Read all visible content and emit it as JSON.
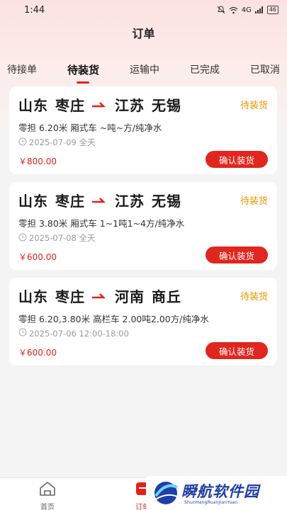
{
  "status_bar": {
    "time": "1:44",
    "network": "4G",
    "battery": "46"
  },
  "header": {
    "title": "订单"
  },
  "tabs": [
    {
      "label": "待接单"
    },
    {
      "label": "待装货",
      "active": true
    },
    {
      "label": "运输中"
    },
    {
      "label": "已完成"
    },
    {
      "label": "已取消"
    }
  ],
  "orders": [
    {
      "origin_province": "山东",
      "origin_city": "枣庄",
      "dest_province": "江苏",
      "dest_city": "无锡",
      "status": "待装货",
      "detail": "零担 6.20米 厢式车 ~吨~方/纯净水",
      "date": "2025-07-09 全天",
      "price": "￥800.00",
      "button": "确认装货"
    },
    {
      "origin_province": "山东",
      "origin_city": "枣庄",
      "dest_province": "江苏",
      "dest_city": "无锡",
      "status": "待装货",
      "detail": "零担 3.80米 厢式车 1~1吨1~4方/纯净水",
      "date": "2025-07-08 全天",
      "price": "￥600.00",
      "button": "确认装货"
    },
    {
      "origin_province": "山东",
      "origin_city": "枣庄",
      "dest_province": "河南",
      "dest_city": "商丘",
      "status": "待装货",
      "detail": "零担 6.20,3.80米 高栏车 2.00吨2.00方/纯净水",
      "date": "2025-07-06 12:00-18:00",
      "price": "￥600.00",
      "button": "确认装货"
    }
  ],
  "bottom_nav": {
    "home_label": "首页",
    "orders_label": "订单"
  },
  "watermark": {
    "title": "瞬航软件园",
    "subtitle": "ShunHangRuanJianYuan"
  },
  "colors": {
    "accent": "#e2231a",
    "status": "#e69500",
    "button": "#e0261e"
  }
}
